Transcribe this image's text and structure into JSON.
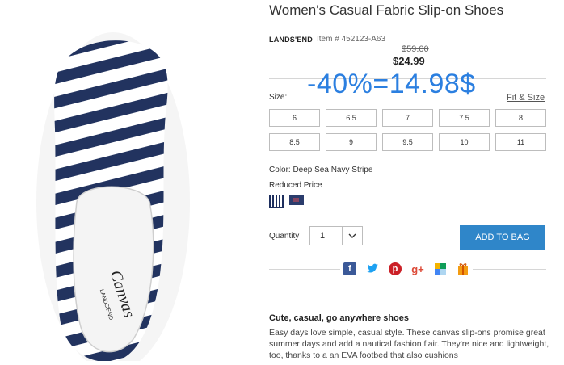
{
  "product": {
    "title": "Women's Casual Fabric Slip-on Shoes",
    "brand": "LANDS'END",
    "item_number": "Item # 452123-A63",
    "original_price": "$59.00",
    "sale_price": "$24.99"
  },
  "overlay_text": "-40%=14.98$",
  "size": {
    "label": "Size:",
    "fit_link": "Fit & Size",
    "options": [
      "6",
      "6.5",
      "7",
      "7.5",
      "8",
      "8.5",
      "9",
      "9.5",
      "10",
      "11"
    ]
  },
  "color": {
    "label": "Color: Deep Sea Navy Stripe",
    "reduced_label": "Reduced Price"
  },
  "quantity": {
    "label": "Quantity",
    "value": "1"
  },
  "add_to_bag": "ADD TO BAG",
  "social_icons": [
    "facebook-icon",
    "twitter-icon",
    "pinterest-icon",
    "google-plus-icon",
    "share-icon",
    "gift-icon"
  ],
  "description": {
    "title": "Cute, casual, go anywhere shoes",
    "text": "Easy days love simple, casual style. These canvas slip-ons promise great summer days and add a nautical fashion flair. They're nice and lightweight, too, thanks to a an EVA footbed that also cushions"
  },
  "shoe_image": {
    "insole_brand": "Canvas",
    "insole_sub": "LANDS'END"
  },
  "colors": {
    "navy": "#1e2f5e",
    "accent_button": "#2f86c9",
    "overlay": "#2b7fe0"
  }
}
